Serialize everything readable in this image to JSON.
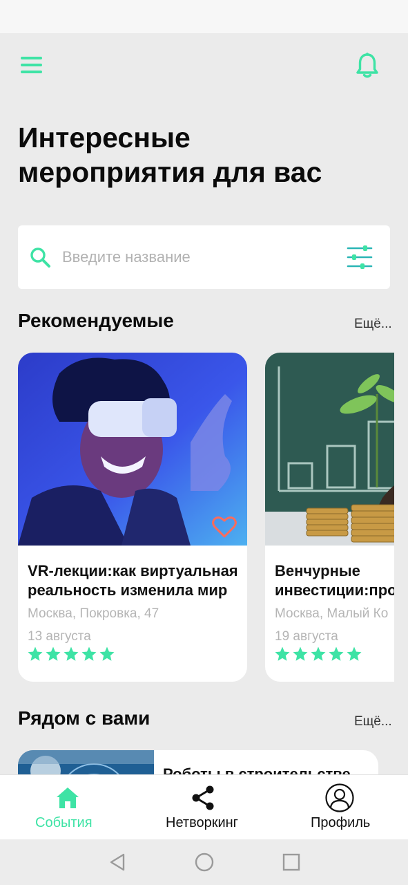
{
  "colors": {
    "accent": "#3ee3a5",
    "background": "#ebebeb",
    "card": "#ffffff",
    "muted_text": "#b5b5b5"
  },
  "header": {
    "menu_icon": "hamburger-menu-icon",
    "notifications_icon": "bell-icon"
  },
  "page": {
    "title_line1": "Интересные",
    "title_line2": "мероприятия для вас"
  },
  "search": {
    "placeholder": "Введите название",
    "value": "",
    "icon": "search-icon",
    "filter_icon": "sliders-filter-icon"
  },
  "recommended": {
    "title": "Рекомендуемые",
    "more_label": "Ещё...",
    "events": [
      {
        "title_line1": "VR-лекции:как виртуальная",
        "title_line2": "реальность изменила мир",
        "place": "Москва, Покровка, 47",
        "date": "13 августа",
        "rating": 5,
        "favorite_icon": "heart-outline-icon"
      },
      {
        "title_line1": "Венчурные",
        "title_line2": "инвестиции:про",
        "place": "Москва, Малый Ко",
        "date": "19 августа",
        "rating": 5
      }
    ]
  },
  "nearby": {
    "title": "Рядом с вами",
    "more_label": "Ещё...",
    "events": [
      {
        "title": "Роботы в строительстве"
      }
    ]
  },
  "bottom_nav": {
    "items": [
      {
        "label": "События",
        "icon": "home-icon",
        "active": true
      },
      {
        "label": "Нетворкинг",
        "icon": "share-icon",
        "active": false
      },
      {
        "label": "Профиль",
        "icon": "profile-icon",
        "active": false
      }
    ]
  },
  "system_nav": {
    "back_icon": "back-triangle-icon",
    "home_icon": "home-circle-icon",
    "recents_icon": "recents-square-icon"
  }
}
